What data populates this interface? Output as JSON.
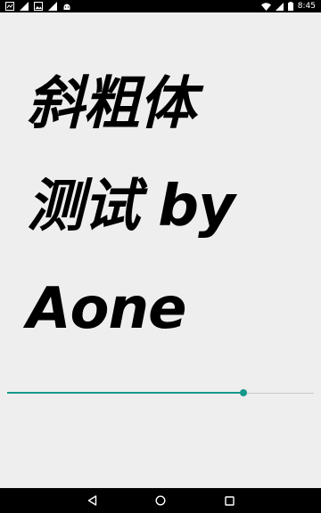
{
  "status_bar": {
    "time": "8:45",
    "left_icons": [
      "app-notification-icon",
      "signal-icon",
      "image-icon",
      "signal-icon",
      "android-icon"
    ],
    "right_icons": [
      "wifi-icon",
      "cellular-icon",
      "battery-icon"
    ]
  },
  "main": {
    "italic_lines": [
      "斜粗体",
      "测试 by",
      "Aone"
    ]
  },
  "seekbar": {
    "progress": 0.77,
    "accent_color": "#17988a",
    "track_color": "#c8c8c8"
  },
  "nav_bar": {
    "buttons": [
      "back-icon",
      "home-icon",
      "recents-icon"
    ]
  },
  "colors": {
    "background": "#eeeeee",
    "status_bar": "#000000",
    "text": "#000000"
  }
}
